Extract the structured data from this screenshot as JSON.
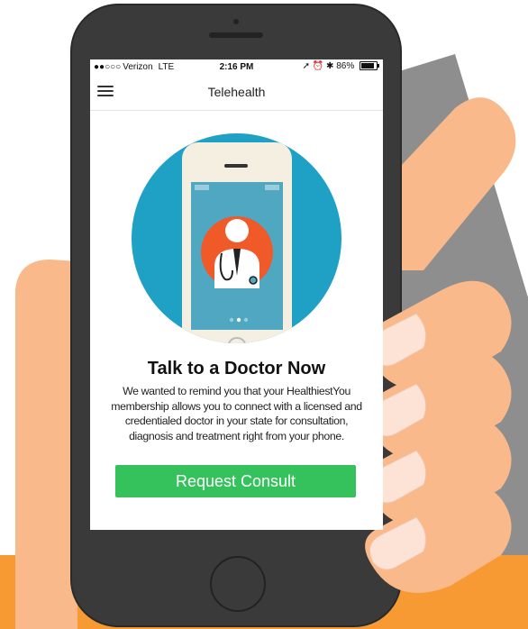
{
  "status_bar": {
    "signal": "●●○○○",
    "carrier": "Verizon",
    "network": "LTE",
    "time": "2:16 PM",
    "icons": "➚ ⏰ ✱",
    "battery": "86%",
    "battery_level": 0.86
  },
  "nav": {
    "menu_icon": "hamburger-menu-icon",
    "title": "Telehealth"
  },
  "hero": {
    "icon": "doctor-on-phone-illustration",
    "pager_dots": 3,
    "active_dot": 1
  },
  "content": {
    "headline": "Talk to a Doctor Now",
    "body": "We wanted to remind you that your HealthiestYou membership allows you to connect with a licensed and credentialed doctor in your state for consultation, diagnosis and treatment right from your phone."
  },
  "cta": {
    "label": "Request Consult"
  },
  "colors": {
    "accent_green": "#35c25c",
    "hero_circle": "#1fa1c6",
    "doctor_orange": "#f05a28",
    "phone_body": "#3a3a3a",
    "hand_skin": "#f9b98a",
    "orange_band": "#f79a33"
  }
}
